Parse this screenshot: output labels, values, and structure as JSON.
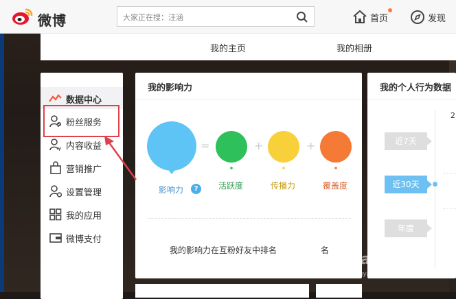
{
  "header": {
    "logo_text": "微博",
    "search_placeholder": "大家正在搜：汪涵",
    "nav": [
      {
        "label": "首页",
        "icon": "home-icon",
        "has_notification": true
      },
      {
        "label": "发现",
        "icon": "compass-icon"
      }
    ]
  },
  "profile_tabs": [
    "我的主页",
    "我的相册"
  ],
  "sidebar": {
    "items": [
      {
        "label": "数据中心",
        "icon": "chart-line-icon",
        "active": true
      },
      {
        "label": "粉丝服务",
        "icon": "fans-icon"
      },
      {
        "label": "内容收益",
        "icon": "income-icon"
      },
      {
        "label": "营销推广",
        "icon": "bag-icon"
      },
      {
        "label": "设置管理",
        "icon": "settings-user-icon"
      },
      {
        "label": "我的应用",
        "icon": "apps-grid-icon"
      },
      {
        "label": "微博支付",
        "icon": "wallet-icon"
      }
    ]
  },
  "influence_card": {
    "title": "我的影响力",
    "metrics": [
      {
        "label": "影响力",
        "color": "#5ec4f5"
      },
      {
        "label": "活跃度",
        "color": "#2ec05a"
      },
      {
        "label": "传播力",
        "color": "#f8d03a"
      },
      {
        "label": "覆盖度",
        "color": "#f57a35"
      }
    ],
    "operators": [
      "=",
      "+",
      "+"
    ],
    "help": "?",
    "rank_text": "我的影响力在互粉好友中排名",
    "rank_suffix": "名"
  },
  "behavior_card": {
    "title": "我的个人行为数据",
    "periods": [
      {
        "label": "近7天",
        "active": false
      },
      {
        "label": "近30天",
        "active": true
      },
      {
        "label": "年度",
        "active": false
      }
    ],
    "value": "2"
  },
  "watermark": {
    "text": "Bai 经验",
    "url": "jingyan.baidu.com"
  },
  "colors": {
    "highlight_box": "#e0404a",
    "active_period": "#6ec0f2",
    "accent": "#fa7d3c"
  }
}
